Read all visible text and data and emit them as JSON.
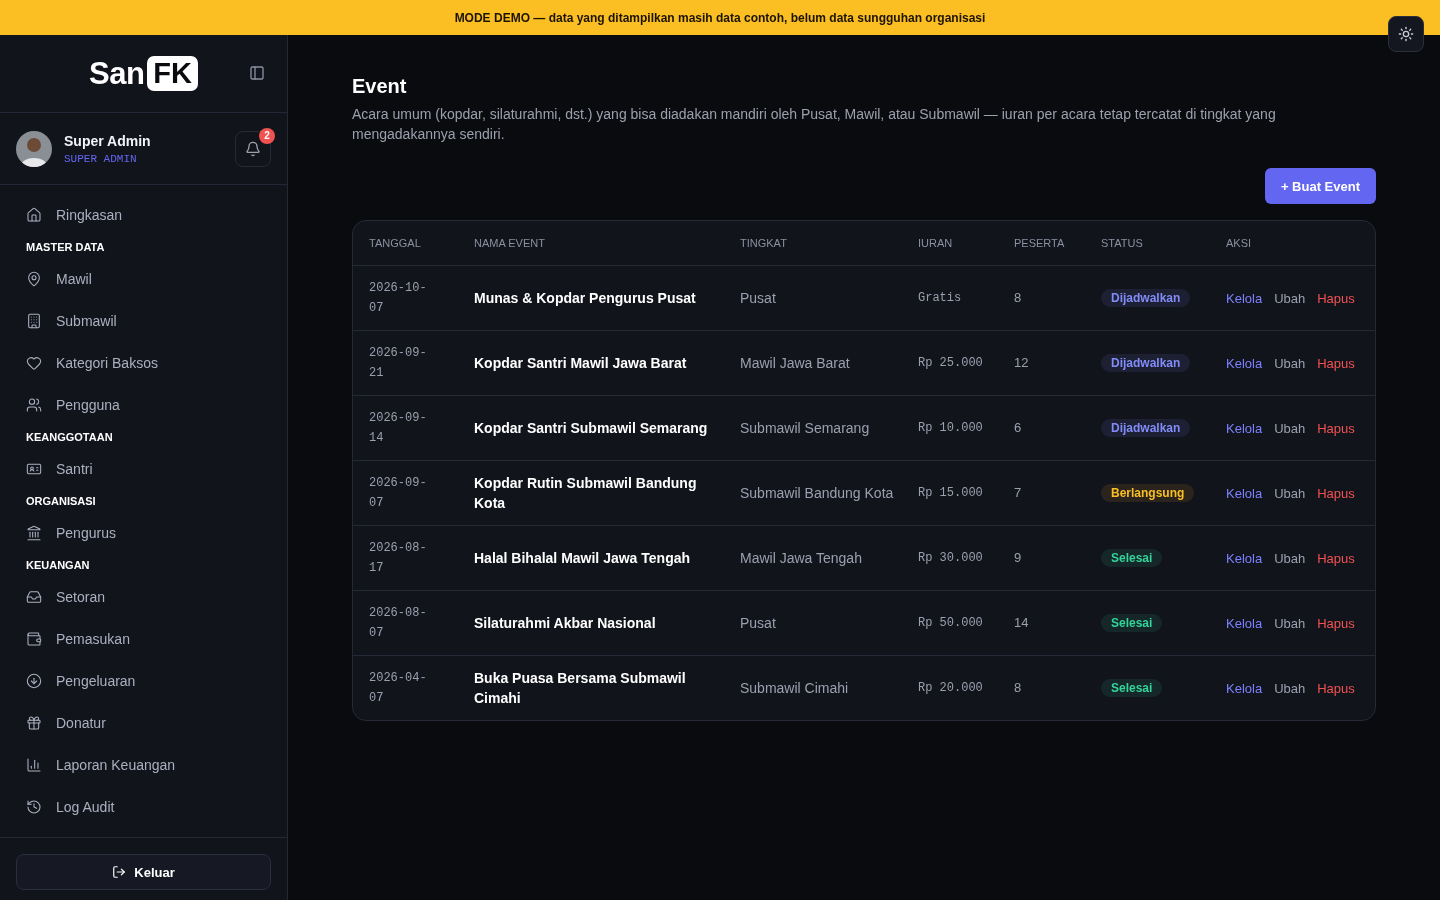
{
  "banner": {
    "text": "MODE DEMO — data yang ditampilkan masih data contoh, belum data sungguhan organisasi"
  },
  "sidebar": {
    "logo": {
      "word": "San",
      "mark": "FK"
    },
    "user": {
      "name": "Super Admin",
      "role": "SUPER ADMIN",
      "notifications": "2"
    },
    "items": [
      {
        "kind": "item",
        "label": "Ringkasan"
      },
      {
        "kind": "heading",
        "label": "MASTER DATA"
      },
      {
        "kind": "item",
        "label": "Mawil"
      },
      {
        "kind": "item",
        "label": "Submawil"
      },
      {
        "kind": "item",
        "label": "Kategori Baksos"
      },
      {
        "kind": "item",
        "label": "Pengguna"
      },
      {
        "kind": "heading",
        "label": "KEANGGOTAAN"
      },
      {
        "kind": "item",
        "label": "Santri"
      },
      {
        "kind": "heading",
        "label": "ORGANISASI"
      },
      {
        "kind": "item",
        "label": "Pengurus"
      },
      {
        "kind": "heading",
        "label": "KEUANGAN"
      },
      {
        "kind": "item",
        "label": "Setoran"
      },
      {
        "kind": "item",
        "label": "Pemasukan"
      },
      {
        "kind": "item",
        "label": "Pengeluaran"
      },
      {
        "kind": "item",
        "label": "Donatur"
      },
      {
        "kind": "item",
        "label": "Laporan Keuangan"
      },
      {
        "kind": "item",
        "label": "Log Audit"
      }
    ],
    "logout": "Keluar"
  },
  "page": {
    "title": "Event",
    "description": "Acara umum (kopdar, silaturahmi, dst.) yang bisa diadakan mandiri oleh Pusat, Mawil, atau Submawil — iuran per acara tetap tercatat di tingkat yang mengadakannya sendiri.",
    "create_button": "+ Buat Event"
  },
  "table": {
    "columns": [
      "TANGGAL",
      "NAMA EVENT",
      "TINGKAT",
      "IURAN",
      "PESERTA",
      "STATUS",
      "AKSI"
    ],
    "rows": [
      {
        "date": "2026-10-07",
        "name": "Munas & Kopdar Pengurus Pusat",
        "level_name": "Pusat",
        "fee": "Gratis",
        "participants": "8",
        "status": "Dijadwalkan",
        "color": "#818cf8",
        "actions": [
          "Kelola",
          "Ubah",
          "Hapus"
        ]
      },
      {
        "date": "2026-09-21",
        "name": "Kopdar Santri Mawil Jawa Barat",
        "level_name": "Mawil Jawa Barat",
        "fee": "Rp 25.000",
        "participants": "12",
        "status": "Dijadwalkan",
        "color": "#818cf8",
        "actions": [
          "Kelola",
          "Ubah",
          "Hapus"
        ]
      },
      {
        "date": "2026-09-14",
        "name": "Kopdar Santri Submawil Semarang",
        "level_name": "Submawil Semarang",
        "fee": "Rp 10.000",
        "participants": "6",
        "status": "Dijadwalkan",
        "color": "#818cf8",
        "actions": [
          "Kelola",
          "Ubah",
          "Hapus"
        ]
      },
      {
        "date": "2026-09-07",
        "name": "Kopdar Rutin Submawil Bandung Kota",
        "level_name": "Submawil Bandung Kota",
        "fee": "Rp 15.000",
        "participants": "7",
        "status": "Berlangsung",
        "color": "#fbbf24",
        "actions": [
          "Kelola",
          "Ubah",
          "Hapus"
        ]
      },
      {
        "date": "2026-08-17",
        "name": "Halal Bihalal Mawil Jawa Tengah",
        "level_name": "Mawil Jawa Tengah",
        "fee": "Rp 30.000",
        "participants": "9",
        "status": "Selesai",
        "color": "#34d399",
        "actions": [
          "Kelola",
          "Ubah",
          "Hapus"
        ]
      },
      {
        "date": "2026-08-07",
        "name": "Silaturahmi Akbar Nasional",
        "level_name": "Pusat",
        "fee": "Rp 50.000",
        "participants": "14",
        "status": "Selesai",
        "color": "#34d399",
        "actions": [
          "Kelola",
          "Ubah",
          "Hapus"
        ]
      },
      {
        "date": "2026-04-07",
        "name": "Buka Puasa Bersama Submawil Cimahi",
        "level_name": "Submawil Cimahi",
        "fee": "Rp 20.000",
        "participants": "8",
        "status": "Selesai",
        "color": "#34d399",
        "actions": [
          "Kelola",
          "Ubah",
          "Hapus"
        ]
      }
    ]
  }
}
